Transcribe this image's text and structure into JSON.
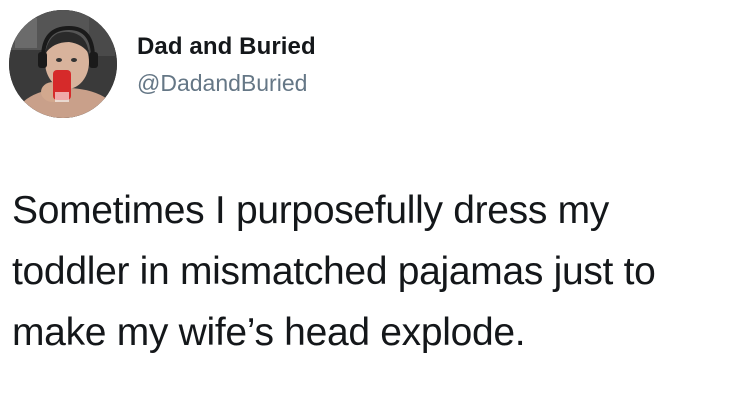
{
  "tweet": {
    "author": {
      "display_name": "Dad and Buried",
      "handle": "@DadandBuried",
      "avatar": "profile-photo"
    },
    "text_lines": [
      "Sometimes I purposefully dress my",
      "toddler in mismatched pajamas just to",
      "make my wife’s head explode."
    ]
  },
  "colors": {
    "text": "#14171a",
    "handle": "#657786",
    "background": "#ffffff"
  }
}
